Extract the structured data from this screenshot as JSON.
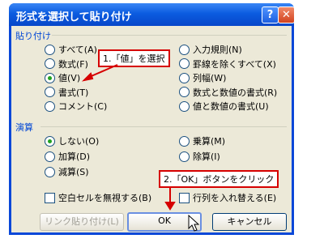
{
  "window": {
    "title": "形式を選択して貼り付け",
    "help_label": "?",
    "close_label": "✕"
  },
  "paste": {
    "group_label": "貼り付け",
    "options": [
      {
        "label": "すべて(A)",
        "selected": false
      },
      {
        "label": "数式(F)",
        "selected": false
      },
      {
        "label": "値(V)",
        "selected": true
      },
      {
        "label": "書式(T)",
        "selected": false
      },
      {
        "label": "コメント(C)",
        "selected": false
      },
      {
        "label": "入力規則(N)",
        "selected": false
      },
      {
        "label": "罫線を除くすべて(X)",
        "selected": false
      },
      {
        "label": "列幅(W)",
        "selected": false
      },
      {
        "label": "数式と数値の書式(R)",
        "selected": false
      },
      {
        "label": "値と数値の書式(U)",
        "selected": false
      }
    ]
  },
  "operation": {
    "group_label": "演算",
    "options": [
      {
        "label": "しない(O)",
        "selected": true
      },
      {
        "label": "加算(D)",
        "selected": false
      },
      {
        "label": "減算(S)",
        "selected": false
      },
      {
        "label": "乗算(M)",
        "selected": false
      },
      {
        "label": "除算(I)",
        "selected": false
      }
    ]
  },
  "checkboxes": {
    "skip_blanks": {
      "label": "空白セルを無視する(B)",
      "checked": false
    },
    "transpose": {
      "label": "行列を入れ替える(E)",
      "checked": false
    }
  },
  "buttons": {
    "paste_link": "リンク貼り付け(L)",
    "ok": "OK",
    "cancel": "キャンセル"
  },
  "annotations": {
    "step1": "1.「値」を選択",
    "step2": "2.「OK」ボタンをクリック",
    "color": "#d60000"
  }
}
